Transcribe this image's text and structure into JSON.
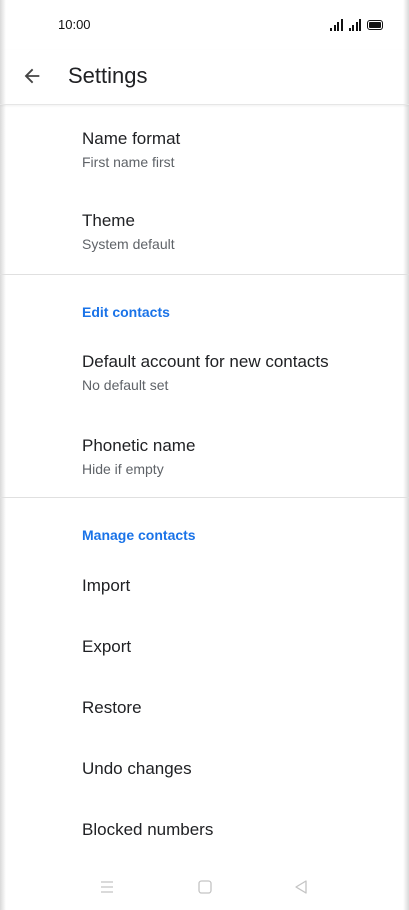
{
  "status_bar": {
    "time": "10:00"
  },
  "app_bar": {
    "title": "Settings",
    "back_icon": "arrow-back-icon"
  },
  "settings": {
    "name_format": {
      "title": "Name format",
      "subtitle": "First name first"
    },
    "theme": {
      "title": "Theme",
      "subtitle": "System default"
    },
    "edit_contacts_header": "Edit contacts",
    "default_account": {
      "title": "Default account for new contacts",
      "subtitle": "No default set"
    },
    "phonetic_name": {
      "title": "Phonetic name",
      "subtitle": "Hide if empty"
    },
    "manage_contacts_header": "Manage contacts",
    "import": "Import",
    "export": "Export",
    "restore": "Restore",
    "undo_changes": "Undo changes",
    "blocked_numbers": "Blocked numbers"
  },
  "colors": {
    "accent": "#1a73e8",
    "text_primary": "#202124",
    "text_secondary": "#5f6368"
  },
  "nav_bar": {
    "icons": [
      "menu-icon",
      "home-square-icon",
      "back-triangle-icon"
    ]
  }
}
